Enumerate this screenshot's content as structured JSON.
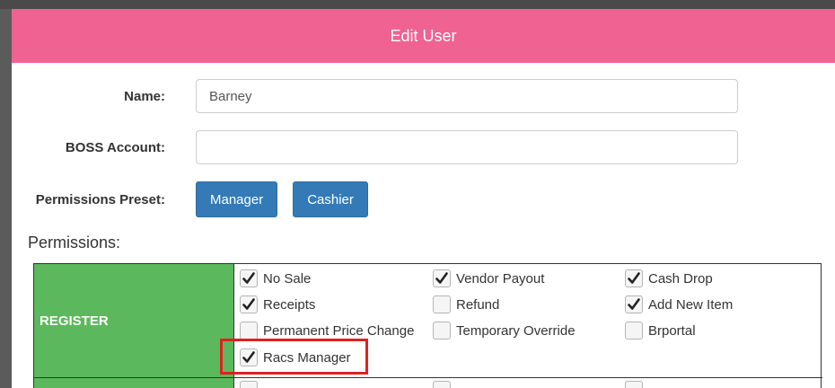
{
  "modal": {
    "title": "Edit User"
  },
  "form": {
    "name_label": "Name:",
    "name_value": "Barney",
    "boss_label": "BOSS Account:",
    "boss_value": "",
    "preset_label": "Permissions Preset:",
    "presets": [
      "Manager",
      "Cashier"
    ]
  },
  "permissions": {
    "heading": "Permissions:",
    "groups": [
      {
        "name": "REGISTER",
        "items": [
          {
            "label": "No Sale",
            "checked": true
          },
          {
            "label": "Vendor Payout",
            "checked": true
          },
          {
            "label": "Cash Drop",
            "checked": true
          },
          {
            "label": "Receipts",
            "checked": true
          },
          {
            "label": "Refund",
            "checked": false
          },
          {
            "label": "Add New Item",
            "checked": true
          },
          {
            "label": "Permanent Price Change",
            "checked": false
          },
          {
            "label": "Temporary Override",
            "checked": false
          },
          {
            "label": "Brportal",
            "checked": false
          },
          {
            "label": "Racs Manager",
            "checked": true,
            "highlighted": true
          }
        ]
      }
    ]
  },
  "colors": {
    "header": "#f06292",
    "group_cell": "#5cb85c",
    "button": "#337ab7",
    "highlight": "#e02020"
  }
}
